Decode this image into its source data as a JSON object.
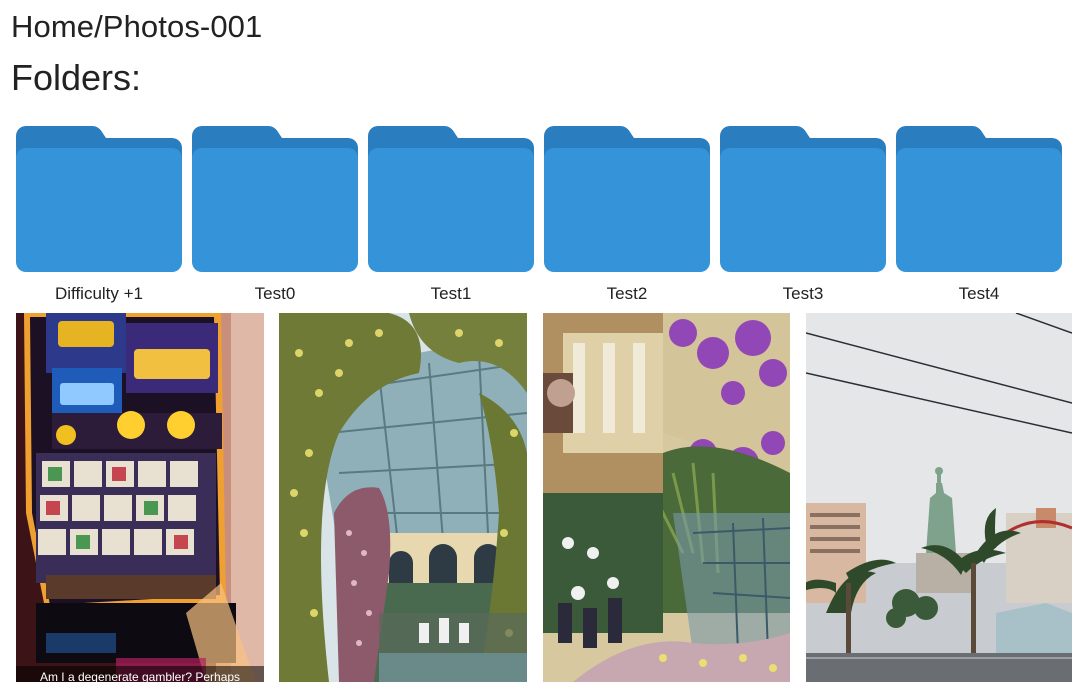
{
  "breadcrumb": "Home/Photos-001",
  "folders_heading": "Folders:",
  "folder_color": "#3493d9",
  "folder_tab_color": "#2a7ebf",
  "folders": [
    {
      "label": "Difficulty +1",
      "icon": "folder-icon"
    },
    {
      "label": "Test0",
      "icon": "folder-icon"
    },
    {
      "label": "Test1",
      "icon": "folder-icon"
    },
    {
      "label": "Test2",
      "icon": "folder-icon"
    },
    {
      "label": "Test3",
      "icon": "folder-icon"
    },
    {
      "label": "Test4",
      "icon": "folder-icon"
    }
  ],
  "photos": [
    {
      "subject": "slot-machine",
      "caption": "Am I a degenerate gambler? Perhaps"
    },
    {
      "subject": "flower-arch-conservatory",
      "caption": ""
    },
    {
      "subject": "conservatory-garden",
      "caption": ""
    },
    {
      "subject": "statue-of-liberty-street",
      "caption": ""
    }
  ]
}
